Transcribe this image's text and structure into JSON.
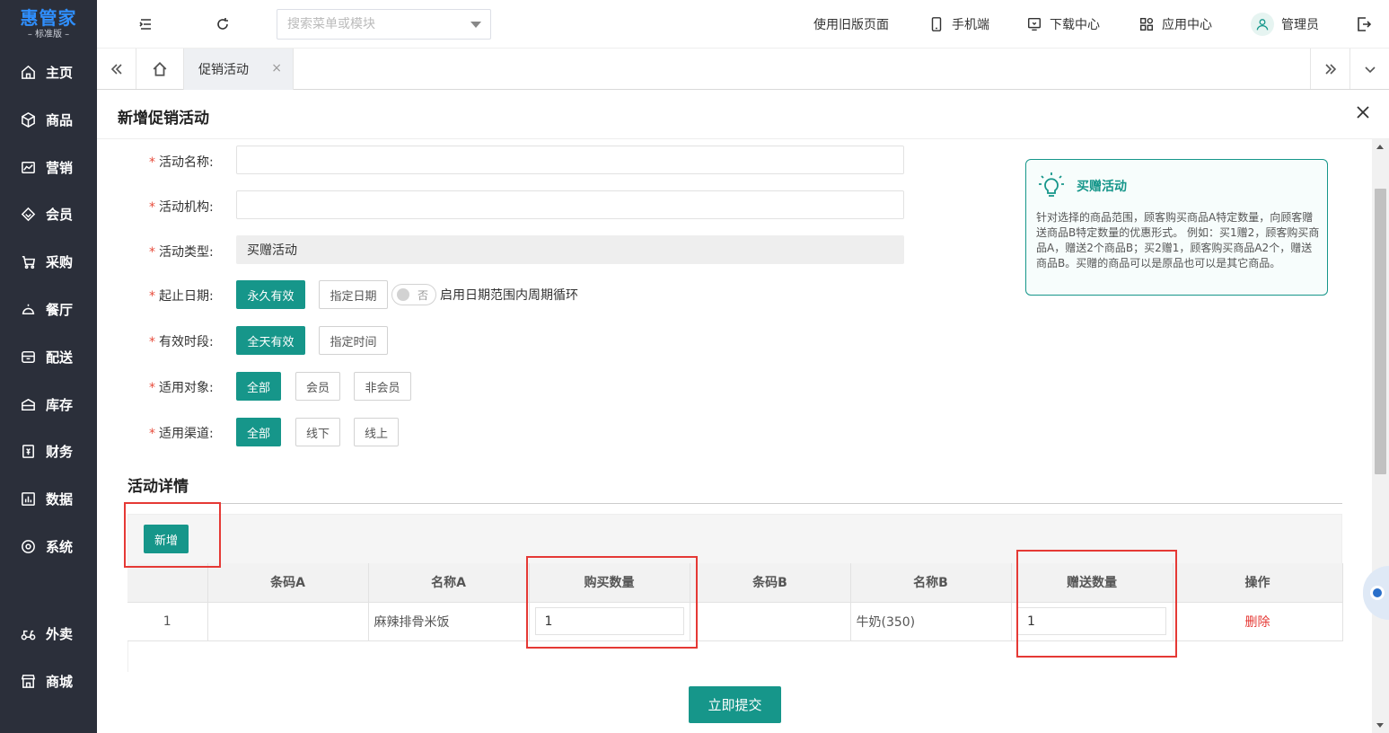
{
  "app": {
    "logo_main": "惠管家",
    "logo_sub": "– 标准版 –"
  },
  "sidebar": {
    "items": [
      {
        "label": "主页",
        "icon": "home-icon"
      },
      {
        "label": "商品",
        "icon": "box-icon"
      },
      {
        "label": "营销",
        "icon": "chart-icon"
      },
      {
        "label": "会员",
        "icon": "diamond-icon"
      },
      {
        "label": "采购",
        "icon": "cart-icon"
      },
      {
        "label": "餐厅",
        "icon": "cloche-icon"
      },
      {
        "label": "配送",
        "icon": "delivery-icon"
      },
      {
        "label": "库存",
        "icon": "warehouse-icon"
      },
      {
        "label": "财务",
        "icon": "finance-icon"
      },
      {
        "label": "数据",
        "icon": "data-icon"
      },
      {
        "label": "系统",
        "icon": "settings-icon"
      },
      {
        "label": "外卖",
        "icon": "scooter-icon"
      },
      {
        "label": "商城",
        "icon": "store-icon"
      }
    ]
  },
  "topbar": {
    "search_placeholder": "搜索菜单或模块",
    "old_page": "使用旧版页面",
    "mobile": "手机端",
    "download": "下载中心",
    "apps": "应用中心",
    "user": "管理员"
  },
  "tabs": {
    "active_label": "促销活动",
    "close_glyph": "×"
  },
  "modal": {
    "title": "新增促销活动",
    "fields": {
      "name_label": "活动名称:",
      "org_label": "活动机构:",
      "type_label": "活动类型:",
      "type_value": "买赠活动",
      "date_label": "起止日期:",
      "date_forever": "永久有效",
      "date_specific": "指定日期",
      "toggle_text": "否",
      "cycle_label": "启用日期范围内周期循环",
      "period_label": "有效时段:",
      "period_allday": "全天有效",
      "period_specific": "指定时间",
      "target_label": "适用对象:",
      "target_all": "全部",
      "target_member": "会员",
      "target_nonmember": "非会员",
      "channel_label": "适用渠道:",
      "channel_all": "全部",
      "channel_offline": "线下",
      "channel_online": "线上"
    },
    "info": {
      "title": "买赠活动",
      "desc": "针对选择的商品范围，顾客购买商品A特定数量，向顾客赠送商品B特定数量的优惠形式。 例如：买1赠2，顾客购买商品A，赠送2个商品B；买2赠1，顾客购买商品A2个，赠送商品B。买赠的商品可以是原品也可以是其它商品。"
    },
    "detail": {
      "section_title": "活动详情",
      "add_button": "新增",
      "columns": [
        "",
        "条码A",
        "名称A",
        "购买数量",
        "条码B",
        "名称B",
        "赠送数量",
        "操作"
      ],
      "rows": [
        {
          "index": "1",
          "barcode_a": "",
          "name_a": "麻辣排骨米饭",
          "buy_qty": "1",
          "barcode_b": "",
          "name_b": "牛奶(350)",
          "gift_qty": "1",
          "action": "删除"
        }
      ]
    },
    "submit": "立即提交"
  },
  "colors": {
    "primary": "#16968a",
    "sidebar_bg": "#2b2f3a",
    "danger": "#e53935",
    "logo": "#2f8fff"
  }
}
